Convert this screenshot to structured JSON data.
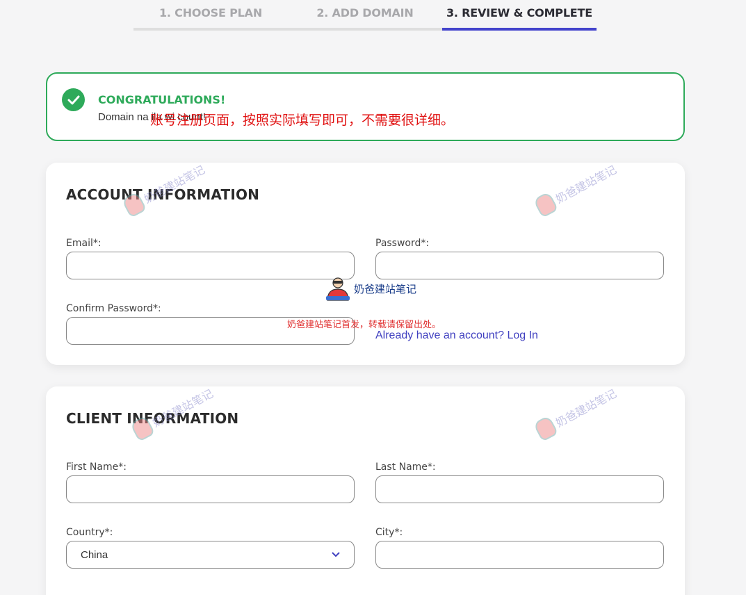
{
  "steps": [
    {
      "label": "1. CHOOSE PLAN"
    },
    {
      "label": "2. ADD DOMAIN"
    },
    {
      "label": "3. REVIEW & COMPLETE"
    }
  ],
  "banner": {
    "title": "CONGRATULATIONS!",
    "message": "Domain na              ila                                               wi                       count!",
    "overlay_note": "账号注册页面，按照实际填写即可，不需要很详细。"
  },
  "account": {
    "title": "ACCOUNT INFORMATION",
    "email_label": "Email*:",
    "password_label": "Password*:",
    "confirm_label": "Confirm Password*:",
    "login_link": "Already have an account? Log In"
  },
  "client": {
    "title": "CLIENT INFORMATION",
    "first_name_label": "First Name*:",
    "last_name_label": "Last Name*:",
    "country_label": "Country*:",
    "country_value": "China",
    "city_label": "City*:"
  },
  "watermark": {
    "text": "奶爸建站笔记",
    "repost_note": "奶爸建站笔记首发，转载请保留出处。"
  },
  "colors": {
    "accent": "#4444cc",
    "success": "#2eaa5a",
    "link": "#4040c0",
    "note_red": "#e01010"
  }
}
